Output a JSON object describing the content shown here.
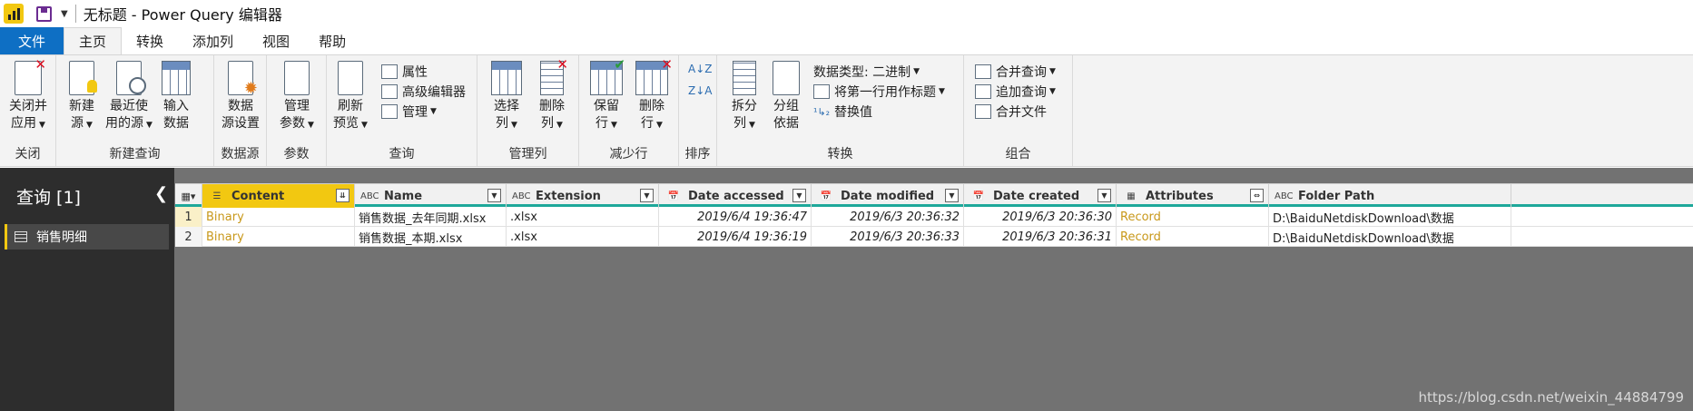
{
  "window": {
    "title": "无标题 - Power Query 编辑器"
  },
  "tabs": [
    "文件",
    "主页",
    "转换",
    "添加列",
    "视图",
    "帮助"
  ],
  "ribbon": {
    "close": {
      "btn": "关闭并",
      "btn2": "应用",
      "group": "关闭"
    },
    "new_query": {
      "new_source": "新建",
      "new_source2": "源",
      "recent": "最近使",
      "recent2": "用的源",
      "enter": "输入",
      "enter2": "数据",
      "group": "新建查询"
    },
    "data_source": {
      "settings": "数据",
      "settings2": "源设置",
      "group": "数据源"
    },
    "params": {
      "manage": "管理",
      "manage2": "参数",
      "group": "参数"
    },
    "query": {
      "refresh": "刷新",
      "refresh2": "预览",
      "properties": "属性",
      "advanced": "高级编辑器",
      "manage": "管理",
      "group": "查询"
    },
    "manage_cols": {
      "choose": "选择",
      "choose2": "列",
      "remove": "删除",
      "remove2": "列",
      "group": "管理列"
    },
    "reduce_rows": {
      "keep": "保留",
      "keep2": "行",
      "remove": "删除",
      "remove2": "行",
      "group": "减少行"
    },
    "sort": {
      "group": "排序"
    },
    "transform": {
      "split": "拆分",
      "split2": "列",
      "groupby": "分组",
      "groupby2": "依据",
      "datatype": "数据类型: 二进制",
      "firstrow": "将第一行用作标题",
      "replace": "替换值",
      "group": "转换"
    },
    "combine": {
      "merge": "合并查询",
      "append": "追加查询",
      "files": "合并文件",
      "group": "组合"
    }
  },
  "queries": {
    "title": "查询 [1]",
    "items": [
      "销售明细"
    ]
  },
  "table": {
    "columns": [
      {
        "name": "Content",
        "type": "☰"
      },
      {
        "name": "Name",
        "type": "ABC"
      },
      {
        "name": "Extension",
        "type": "ABC"
      },
      {
        "name": "Date accessed",
        "type": "📅"
      },
      {
        "name": "Date modified",
        "type": "📅"
      },
      {
        "name": "Date created",
        "type": "📅"
      },
      {
        "name": "Attributes",
        "type": "▦"
      },
      {
        "name": "Folder Path",
        "type": "ABC"
      }
    ],
    "rows": [
      {
        "n": "1",
        "content": "Binary",
        "name": "销售数据_去年同期.xlsx",
        "ext": ".xlsx",
        "accessed": "2019/6/4 19:36:47",
        "modified": "2019/6/3 20:36:32",
        "created": "2019/6/3 20:36:30",
        "attr": "Record",
        "path": "D:\\BaiduNetdiskDownload\\数据"
      },
      {
        "n": "2",
        "content": "Binary",
        "name": "销售数据_本期.xlsx",
        "ext": ".xlsx",
        "accessed": "2019/6/4 19:36:19",
        "modified": "2019/6/3 20:36:33",
        "created": "2019/6/3 20:36:31",
        "attr": "Record",
        "path": "D:\\BaiduNetdiskDownload\\数据"
      }
    ]
  },
  "watermark": "https://blog.csdn.net/weixin_44884799"
}
